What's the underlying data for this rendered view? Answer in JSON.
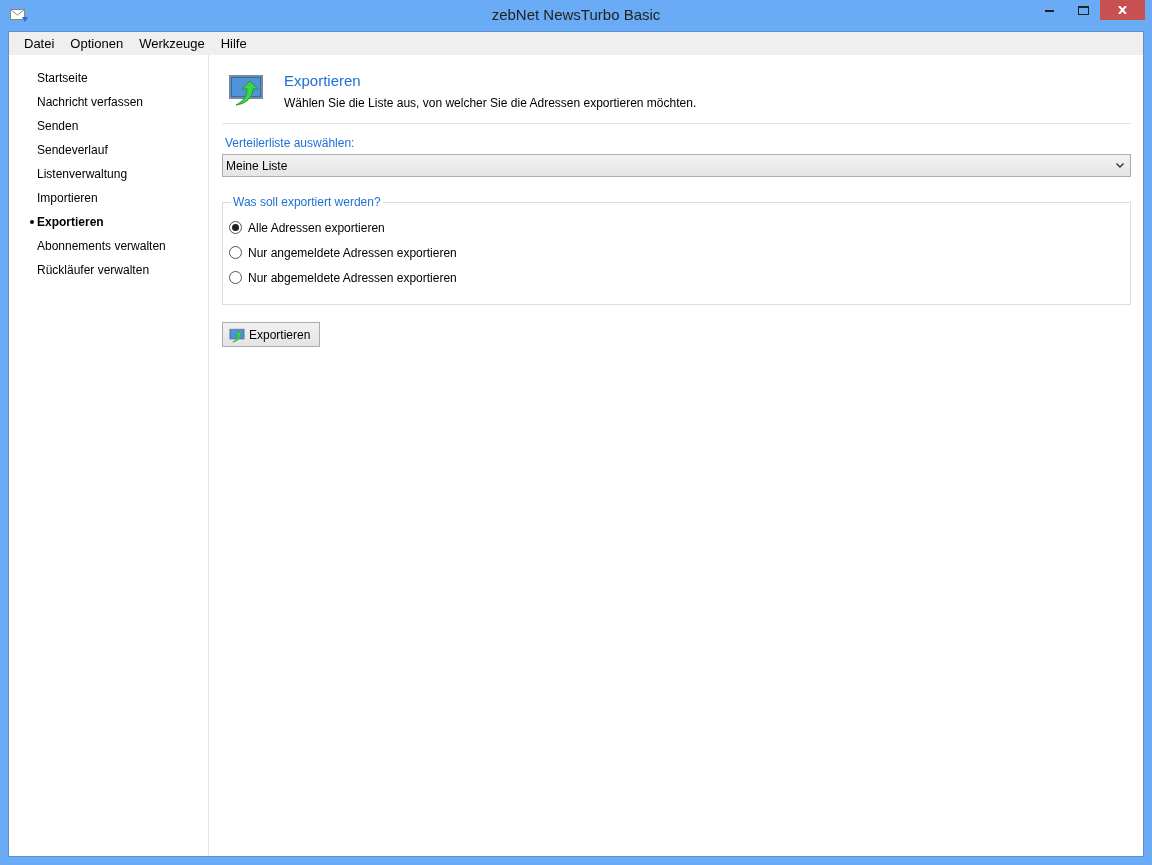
{
  "window": {
    "title": "zebNet NewsTurbo Basic"
  },
  "menu": [
    "Datei",
    "Optionen",
    "Werkzeuge",
    "Hilfe"
  ],
  "sidebar": {
    "items": [
      {
        "label": "Startseite",
        "selected": false
      },
      {
        "label": "Nachricht verfassen",
        "selected": false
      },
      {
        "label": "Senden",
        "selected": false
      },
      {
        "label": "Sendeverlauf",
        "selected": false
      },
      {
        "label": "Listenverwaltung",
        "selected": false
      },
      {
        "label": "Importieren",
        "selected": false
      },
      {
        "label": "Exportieren",
        "selected": true
      },
      {
        "label": "Abonnements verwalten",
        "selected": false
      },
      {
        "label": "Rückläufer verwalten",
        "selected": false
      }
    ]
  },
  "header": {
    "title": "Exportieren",
    "description": "Wählen Sie die Liste aus, von welcher Sie die Adressen exportieren möchten."
  },
  "list_select": {
    "label": "Verteilerliste auswählen:",
    "value": "Meine Liste"
  },
  "export_group": {
    "title": "Was soll exportiert werden?",
    "options": [
      {
        "label": "Alle Adressen exportieren",
        "selected": true
      },
      {
        "label": "Nur angemeldete Adressen exportieren",
        "selected": false
      },
      {
        "label": "Nur abgemeldete Adressen exportieren",
        "selected": false
      }
    ]
  },
  "export_button": "Exportieren"
}
